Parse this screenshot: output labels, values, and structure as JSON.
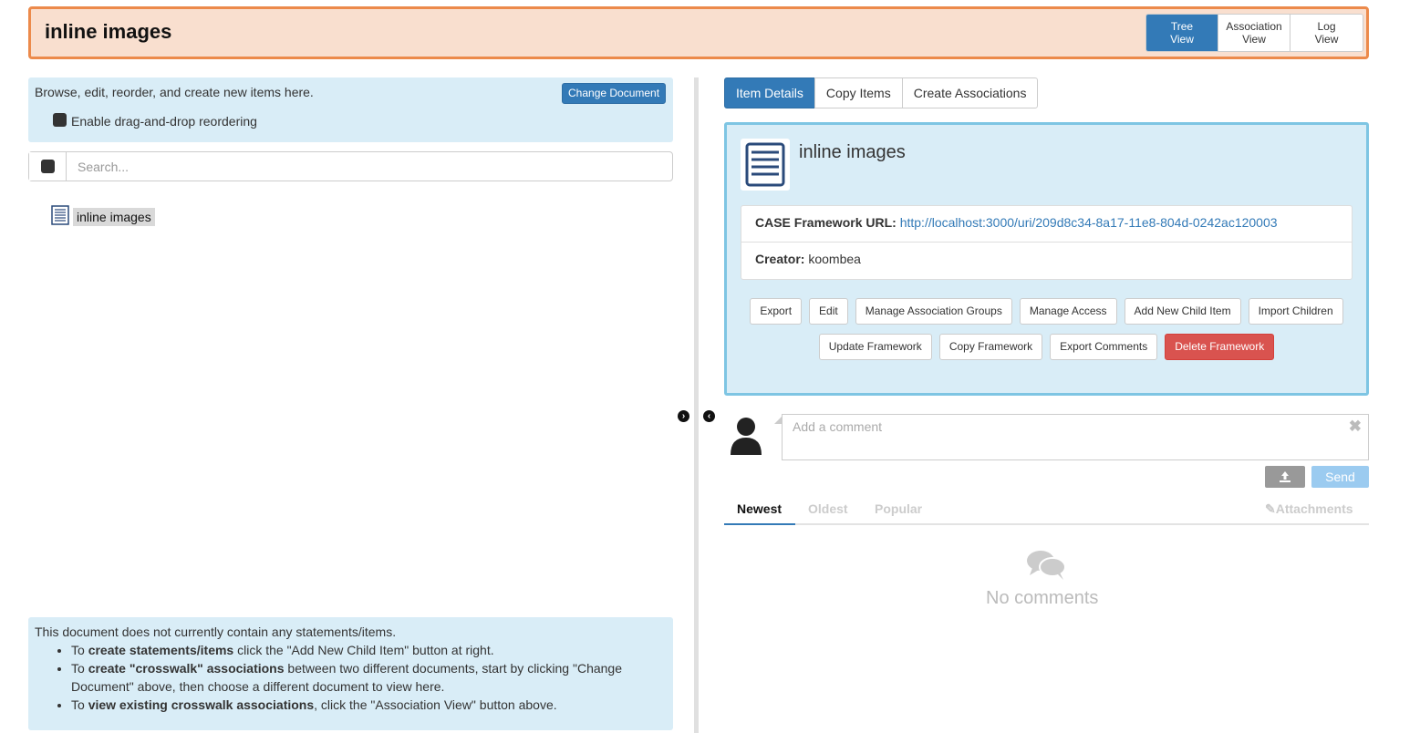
{
  "header": {
    "title": "inline images",
    "views": [
      {
        "line1": "Tree",
        "line2": "View"
      },
      {
        "line1": "Association",
        "line2": "View"
      },
      {
        "line1": "Log",
        "line2": "View"
      }
    ]
  },
  "left": {
    "info_text": "Browse, edit, reorder, and create new items here.",
    "change_document_label": "Change Document",
    "dnd_label": "Enable drag-and-drop reordering",
    "search_placeholder": "Search...",
    "tree_item_label": "inline images",
    "help": {
      "intro": "This document does not currently contain any statements/items.",
      "b1_prefix": "To ",
      "b1_bold": "create statements/items",
      "b1_suffix": " click the \"Add New Child Item\" button at right.",
      "b2_prefix": "To ",
      "b2_bold": "create \"crosswalk\" associations",
      "b2_suffix": " between two different documents, start by clicking \"Change Document\" above, then choose a different document to view here.",
      "b3_prefix": "To ",
      "b3_bold": "view existing crosswalk associations",
      "b3_suffix": ", click the \"Association View\" button above."
    }
  },
  "tabs": [
    "Item Details",
    "Copy Items",
    "Create Associations"
  ],
  "details": {
    "title": "inline images",
    "url_label": "CASE Framework URL:",
    "url_value": "http://localhost:3000/uri/209d8c34-8a17-11e8-804d-0242ac120003",
    "creator_label": "Creator:",
    "creator_value": "koombea",
    "buttons_row1": [
      "Export",
      "Edit",
      "Manage Association Groups",
      "Manage Access",
      "Add New Child Item",
      "Import Children"
    ],
    "buttons_row2": [
      "Update Framework",
      "Copy Framework",
      "Export Comments",
      "Delete Framework"
    ]
  },
  "comments": {
    "placeholder": "Add a comment",
    "send_label": "Send",
    "sort": [
      "Newest",
      "Oldest",
      "Popular"
    ],
    "attachments_label": "Attachments",
    "empty_text": "No comments"
  },
  "colors": {
    "header_bg": "#f9dfcf",
    "header_border": "#ec8a4b",
    "primary": "#337ab7",
    "info_bg": "#d9edf7",
    "danger": "#d9534f"
  }
}
